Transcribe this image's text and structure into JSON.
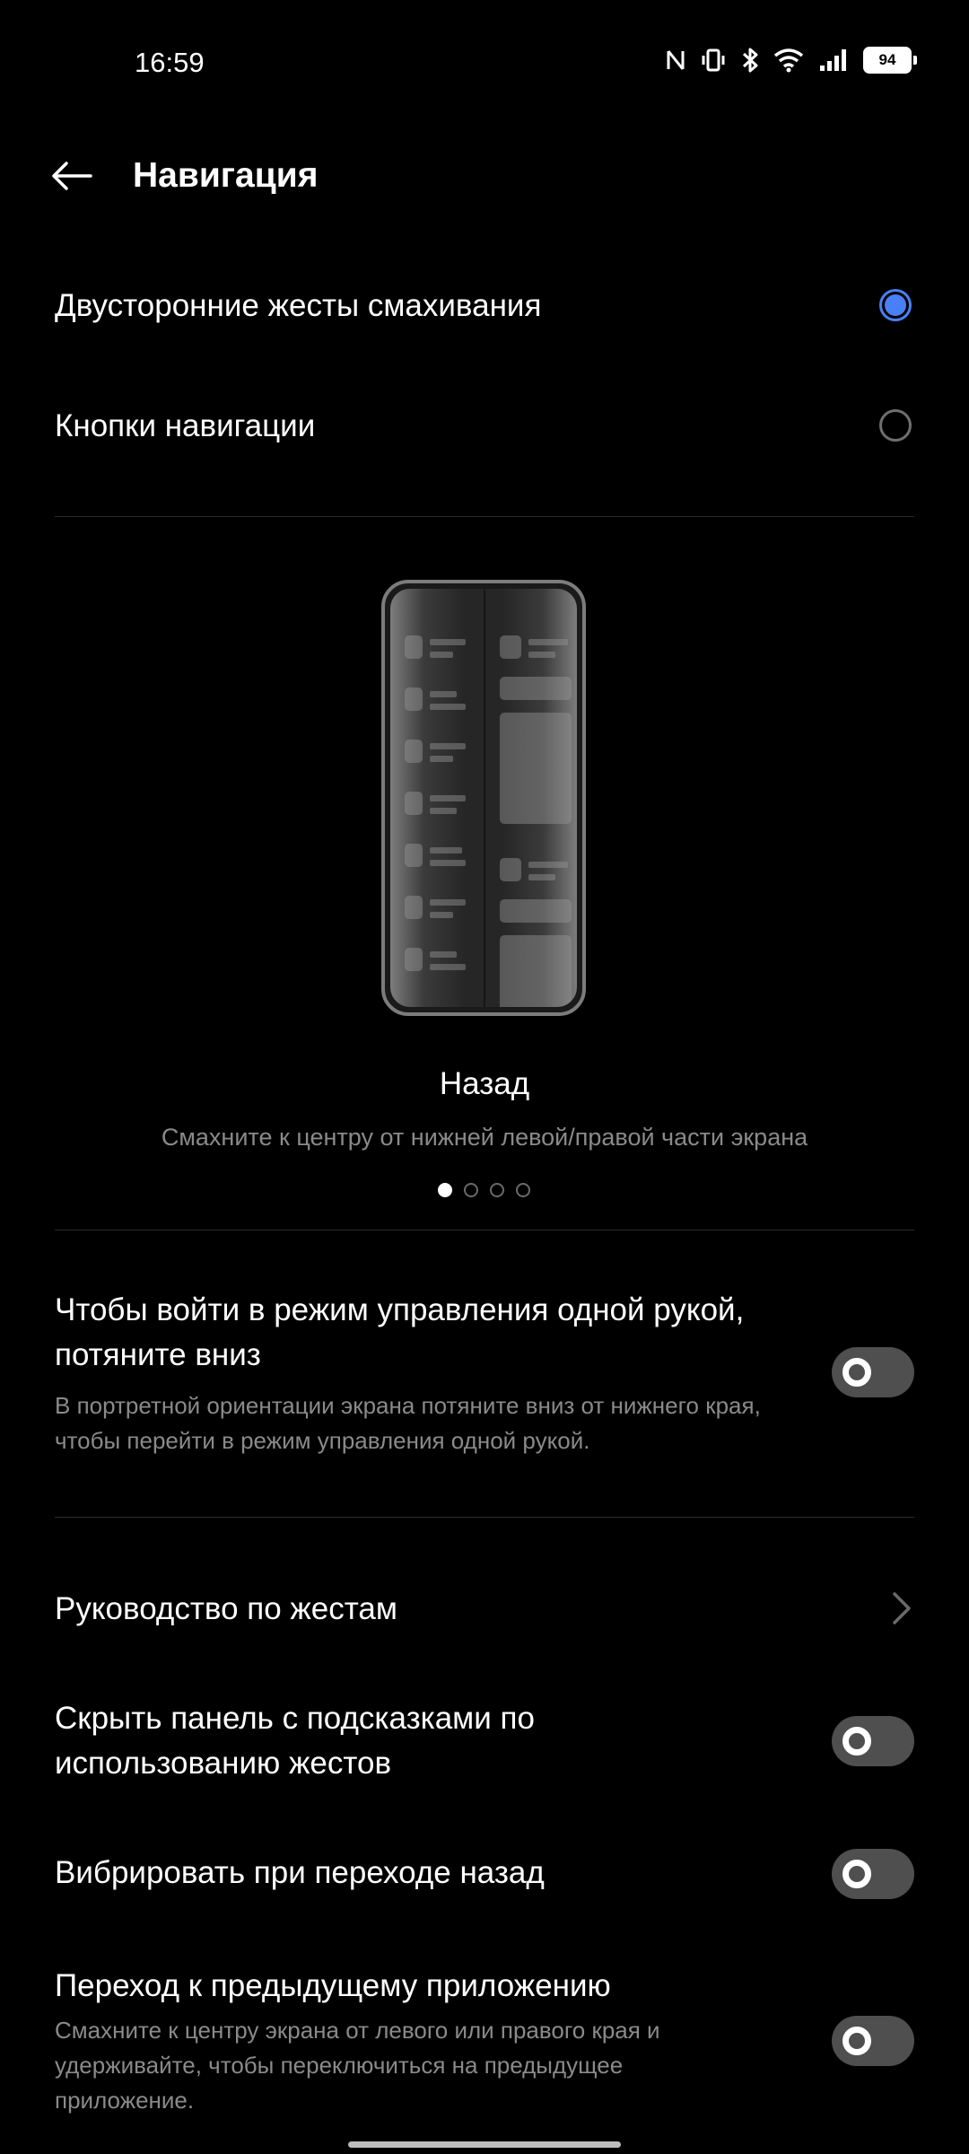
{
  "status_bar": {
    "time": "16:59",
    "battery": "94",
    "icons": [
      "nfc-icon",
      "vibrate-icon",
      "bluetooth-icon",
      "wifi-icon",
      "signal-icon",
      "battery-icon"
    ]
  },
  "header": {
    "title": "Навигация",
    "back_icon": "arrow-left-icon"
  },
  "nav_modes": [
    {
      "label": "Двусторонние жесты смахивания",
      "selected": true
    },
    {
      "label": "Кнопки навигации",
      "selected": false
    }
  ],
  "gesture_demo": {
    "title": "Назад",
    "description": "Смахните к центру от нижней левой/правой части экрана",
    "page_count": 4,
    "current_page": 1
  },
  "settings": {
    "one_hand": {
      "title": "Чтобы войти в режим управления одной рукой, потяните вниз",
      "subtitle": "В портретной ориентации экрана потяните вниз от нижнего края, чтобы перейти в режим управления одной рукой.",
      "enabled": false
    },
    "gesture_guide": {
      "title": "Руководство по жестам"
    },
    "hide_hint_bar": {
      "title": "Скрыть панель с подсказками по использованию жестов",
      "enabled": false
    },
    "vibrate_back": {
      "title": "Вибрировать при переходе назад",
      "enabled": false
    },
    "prev_app": {
      "title": "Переход к предыдущему приложению",
      "subtitle": "Смахните к центру экрана от левого или правого края и удерживайте, чтобы переключиться на предыдущее приложение.",
      "enabled": false
    }
  },
  "colors": {
    "accent": "#4a80f5",
    "background": "#000000",
    "toggle_off": "#4f4f4f",
    "secondary_text": "#8a8a8a"
  }
}
